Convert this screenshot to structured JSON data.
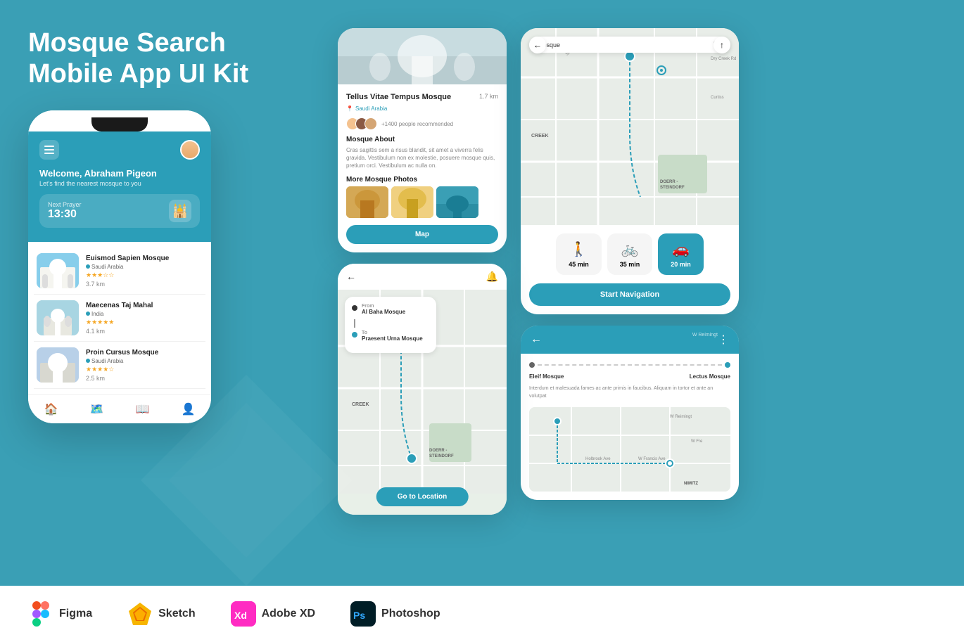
{
  "page": {
    "title": "Mosque Search Mobile App UI Kit",
    "background_color": "#3a9fb5"
  },
  "header": {
    "title_line1": "Mosque Search",
    "title_line2": "Mobile App UI Kit"
  },
  "phone_main": {
    "welcome": "Welcome, Abraham Pigeon",
    "welcome_sub": "Let's find the nearest mosque to you",
    "next_prayer_label": "Next Prayer",
    "next_prayer_time": "13:30",
    "mosques": [
      {
        "name": "Euismod Sapien Mosque",
        "location": "Saudi Arabia",
        "stars": 3,
        "distance": "3.7 km"
      },
      {
        "name": "Maecenas Taj Mahal",
        "location": "India",
        "stars": 5,
        "distance": "4.1 km"
      },
      {
        "name": "Proin Cursus Mosque",
        "location": "Saudi Arabia",
        "stars": 4,
        "distance": "2.5 km"
      }
    ]
  },
  "detail_card": {
    "mosque_name": "Tellus Vitae Tempus Mosque",
    "location": "Saudi Arabia",
    "distance": "1.7 km",
    "recommend_count": "+1400 people recommended",
    "about_title": "Mosque About",
    "about_text": "Cras sagittis sem a risus blandit, sit amet a viverra felis gravida. Vestibulum non ex molestie, posuere mosque quis, pretium orci. Vestibulum ac nulla on.",
    "more_photos_title": "More Mosque Photos",
    "map_btn": "Map"
  },
  "map_navigation": {
    "from_label": "From",
    "from_value": "Al Baha Mosque",
    "to_label": "To",
    "to_value": "Praesent Urna Mosque",
    "go_btn": "Go to Location",
    "map_labels": [
      "CREEK",
      "DOERR -\nSTEINDORF"
    ]
  },
  "nav_detail": {
    "search_placeholder": "Mosque",
    "transport_options": [
      {
        "icon": "🚶",
        "time": "45 min",
        "active": false
      },
      {
        "icon": "🚲",
        "time": "35 min",
        "active": false
      },
      {
        "icon": "🚗",
        "time": "20 min",
        "active": true
      }
    ],
    "start_nav_btn": "Start Navigation",
    "map_labels": [
      "CREEK",
      "DOERR -\nSTEINDORF"
    ]
  },
  "timeline_card": {
    "from_mosque": "Eleif Mosque",
    "to_mosque": "Lectus Mosque",
    "description": "Interdum et malesuada fames ac ante primis in faucibus. Aliquam in tortor et ante an volutpat",
    "map_labels": [
      "W Reimingt",
      "W Fre",
      "NIMITZ"
    ]
  },
  "footer": {
    "tools": [
      {
        "name": "Figma",
        "icon": "figma"
      },
      {
        "name": "Sketch",
        "icon": "sketch"
      },
      {
        "name": "Adobe XD",
        "icon": "xd"
      },
      {
        "name": "Photoshop",
        "icon": "ps"
      }
    ]
  }
}
